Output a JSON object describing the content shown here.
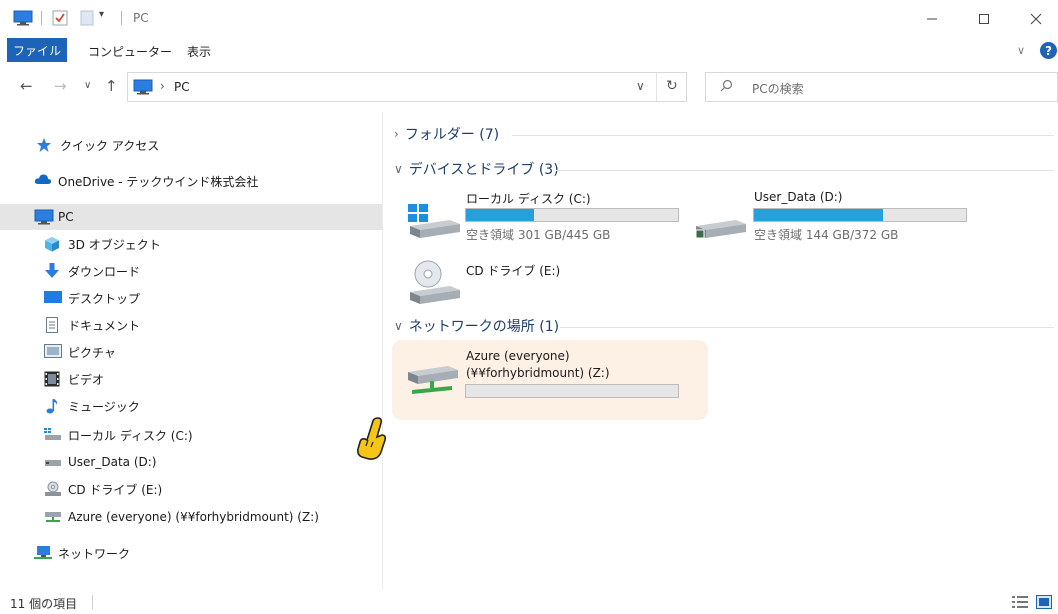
{
  "window": {
    "title": "PC",
    "minimize": "—",
    "maximize": "☐",
    "close": "✕"
  },
  "ribbon": {
    "tabs": [
      {
        "label": "ファイル"
      },
      {
        "label": "コンピューター"
      },
      {
        "label": "表示"
      }
    ],
    "collapse": "∨",
    "help": "?"
  },
  "navigation": {
    "back": "←",
    "forward": "→",
    "recent": "∨",
    "up": "↑",
    "breadcrumb_sep": "›",
    "address": "PC",
    "dropdown": "∨",
    "refresh": "↻",
    "search_placeholder": "PCの検索",
    "search_icon": "⚲"
  },
  "sidebar": {
    "items": [
      {
        "label": "クイック アクセス",
        "icon": "star-icon"
      },
      {
        "label": "OneDrive - テックウインド株式会社",
        "icon": "cloud-icon"
      },
      {
        "label": "PC",
        "icon": "computer-icon",
        "selected": true
      },
      {
        "label": "3D オブジェクト",
        "icon": "cube-icon"
      },
      {
        "label": "ダウンロード",
        "icon": "download-icon"
      },
      {
        "label": "デスクトップ",
        "icon": "desktop-icon"
      },
      {
        "label": "ドキュメント",
        "icon": "document-icon"
      },
      {
        "label": "ピクチャ",
        "icon": "picture-icon"
      },
      {
        "label": "ビデオ",
        "icon": "video-icon"
      },
      {
        "label": "ミュージック",
        "icon": "music-icon"
      },
      {
        "label": "ローカル ディスク (C:)",
        "icon": "local-disk-icon"
      },
      {
        "label": "User_Data (D:)",
        "icon": "drive-icon"
      },
      {
        "label": "CD ドライブ (E:)",
        "icon": "cd-drive-icon"
      },
      {
        "label": "Azure (everyone) (¥¥forhybridmount) (Z:)",
        "icon": "network-drive-icon"
      },
      {
        "label": "ネットワーク",
        "icon": "network-icon"
      }
    ]
  },
  "content": {
    "groups": {
      "folders": {
        "label": "フォルダー (7)",
        "chevron": "›"
      },
      "devices": {
        "label": "デバイスとドライブ (3)",
        "chevron": "∨"
      },
      "network": {
        "label": "ネットワークの場所 (1)",
        "chevron": "∨"
      }
    },
    "drives": [
      {
        "name": "ローカル ディスク (C:)",
        "free": "空き領域 301 GB/445 GB",
        "used_fraction": 0.32
      },
      {
        "name": "User_Data (D:)",
        "free": "空き領域 144 GB/372 GB",
        "used_fraction": 0.61
      },
      {
        "name": "CD ドライブ (E:)"
      }
    ],
    "network_location": {
      "name_line1": "Azure (everyone)",
      "name_line2": "(¥¥forhybridmount) (Z:)",
      "used_fraction": 0.0
    }
  },
  "status": {
    "count": "11 個の項目"
  },
  "colors": {
    "accent": "#1d63b8",
    "drive_fill": "#26a0da",
    "selection": "#e5e5e5",
    "highlight_tile": "#fdf0e5"
  }
}
